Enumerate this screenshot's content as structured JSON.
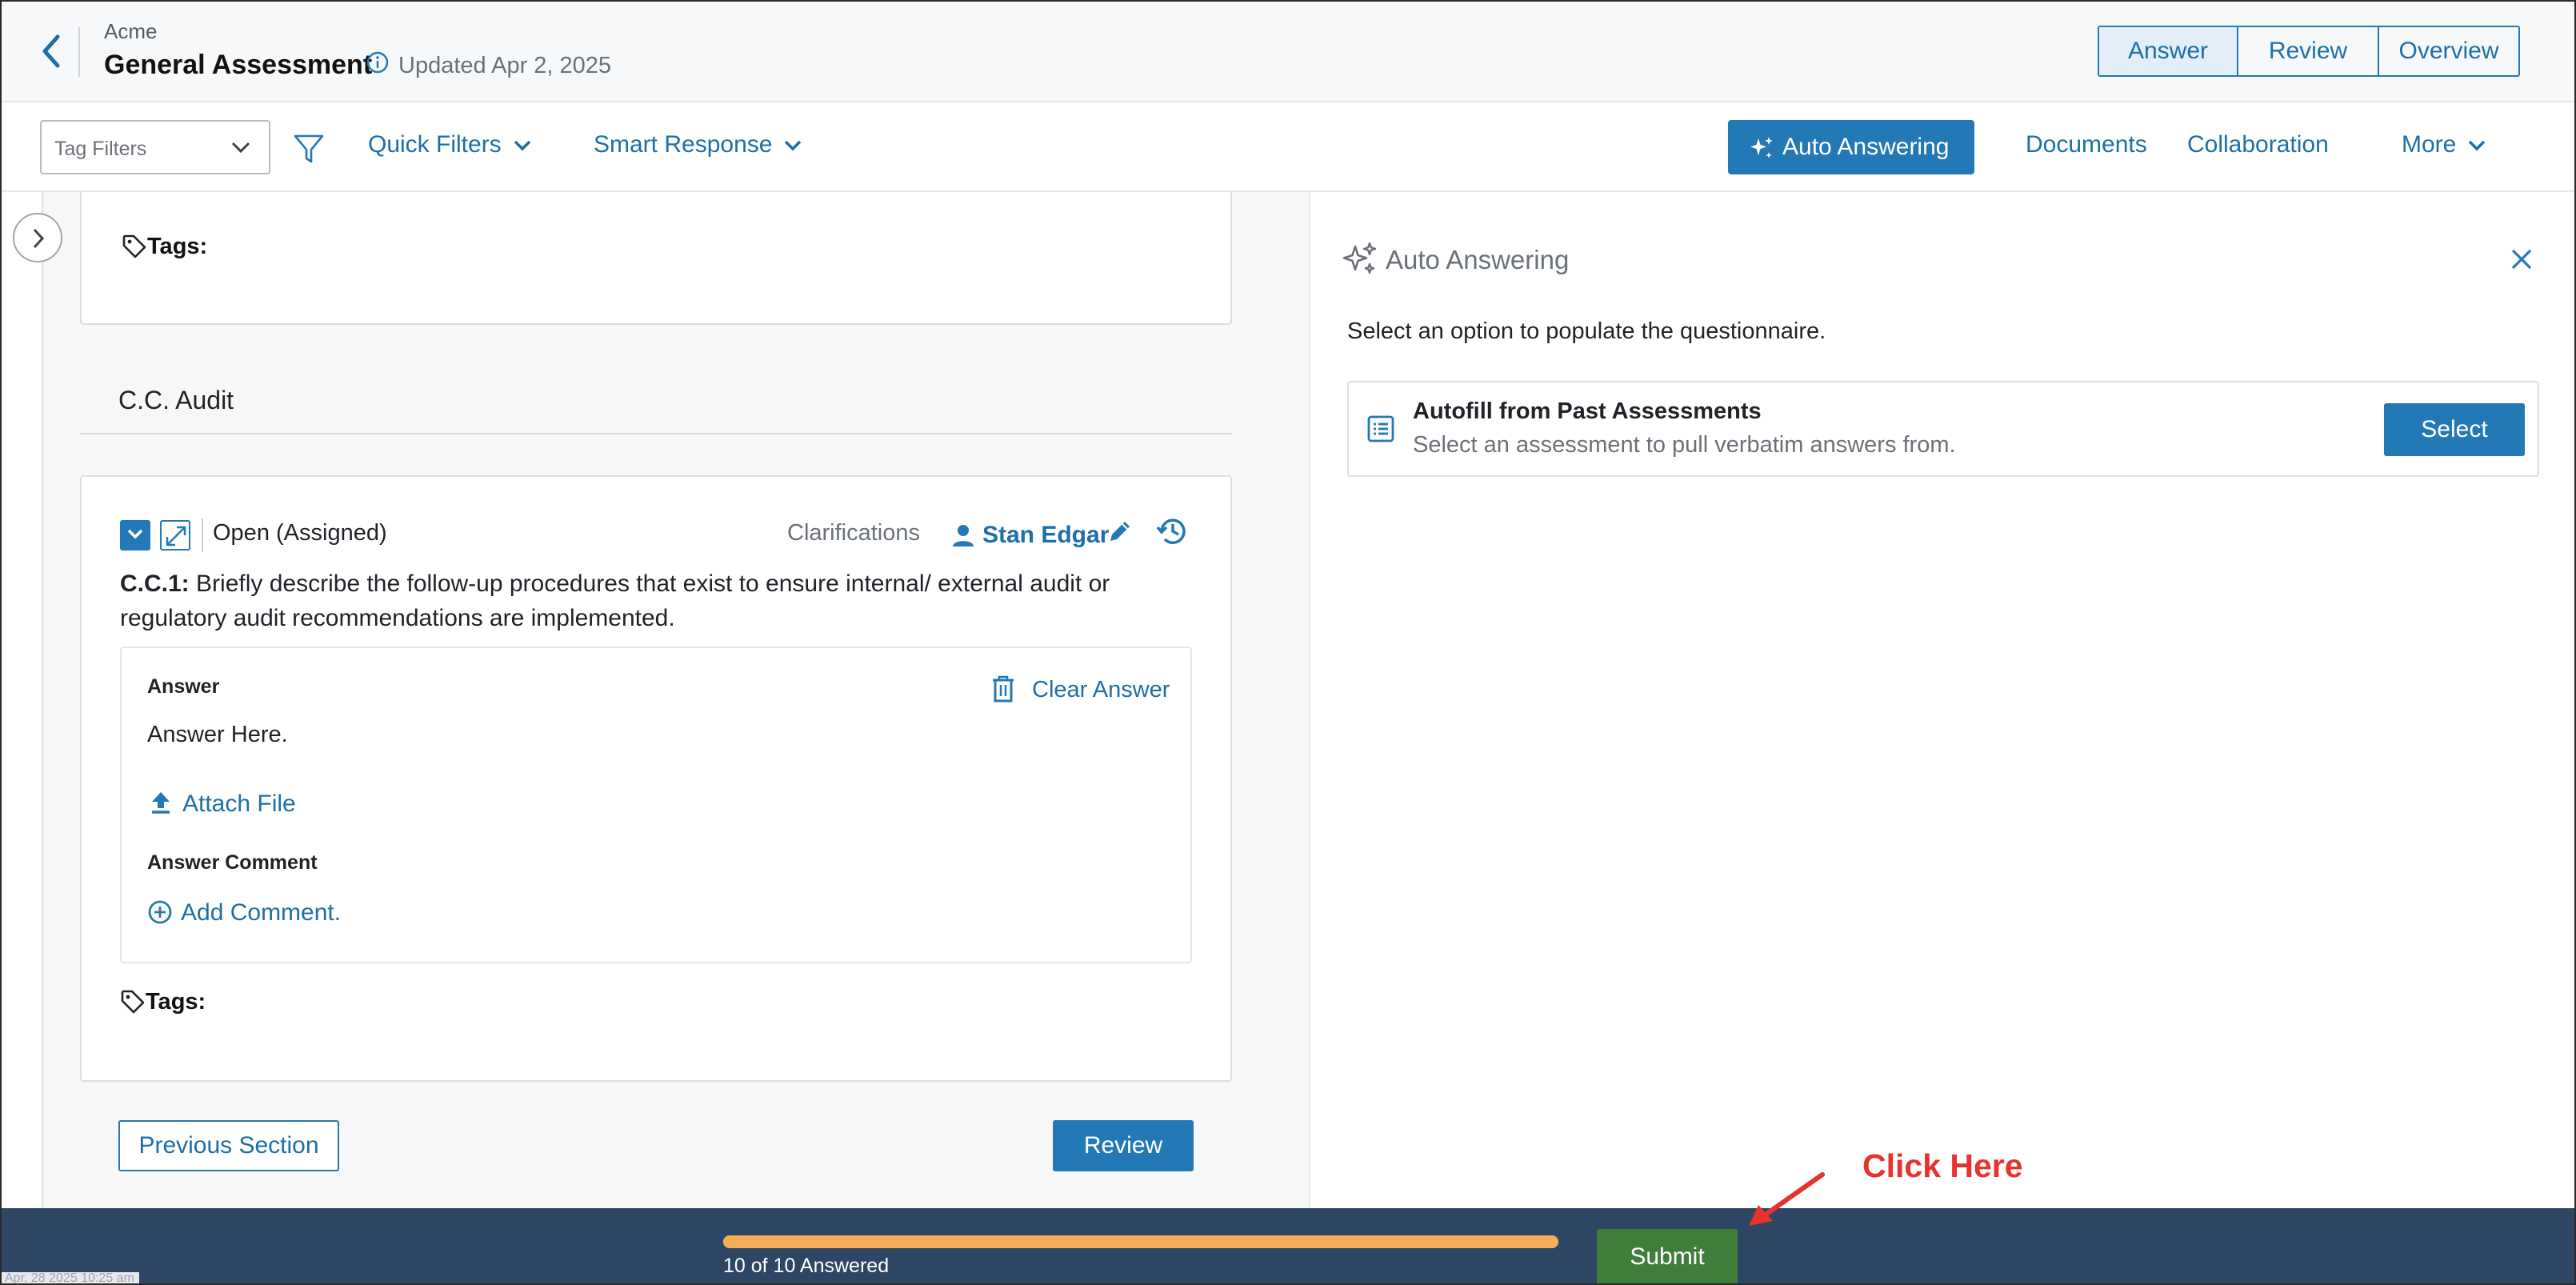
{
  "header": {
    "org": "Acme",
    "title": "General Assessment",
    "updated": "Updated Apr 2, 2025",
    "view_tabs": [
      "Answer",
      "Review",
      "Overview"
    ],
    "active_tab": "Answer"
  },
  "toolbar": {
    "tag_filter_placeholder": "Tag Filters",
    "quick_filters": "Quick Filters",
    "smart_response": "Smart Response",
    "auto_answering": "Auto Answering",
    "documents": "Documents",
    "collaboration": "Collaboration",
    "more": "More"
  },
  "content": {
    "top_tags_label": "Tags:",
    "section_title": "C.C. Audit",
    "question": {
      "status": "Open (Assigned)",
      "clarifications": "Clarifications",
      "assignee": "Stan Edgar",
      "id": "C.C.1:",
      "text": "Briefly describe the follow-up procedures that exist to ensure internal/ external audit or regulatory audit recommendations are implemented.",
      "answer_label": "Answer",
      "clear_answer": "Clear Answer",
      "answer_text": "Answer Here.",
      "attach_file": "Attach File",
      "comment_label": "Answer Comment",
      "add_comment": "Add Comment.",
      "tags_label": "Tags:"
    },
    "previous_section": "Previous Section",
    "review": "Review"
  },
  "panel": {
    "title": "Auto Answering",
    "subtitle": "Select an option to populate the questionnaire.",
    "option_title": "Autofill from Past Assessments",
    "option_desc": "Select an assessment to pull verbatim answers from.",
    "select": "Select"
  },
  "footer": {
    "progress_label": "10 of 10 Answered",
    "progress_fraction": 1.0,
    "submit": "Submit",
    "timestamp": "Apr. 28 2025 10:25 am"
  },
  "annotation": {
    "text": "Click Here",
    "color": "#e8322d"
  },
  "colors": {
    "accent": "#2379b5",
    "submit": "#3f7e3b",
    "footer": "#2d4663",
    "progress": "#f5ad5a"
  }
}
